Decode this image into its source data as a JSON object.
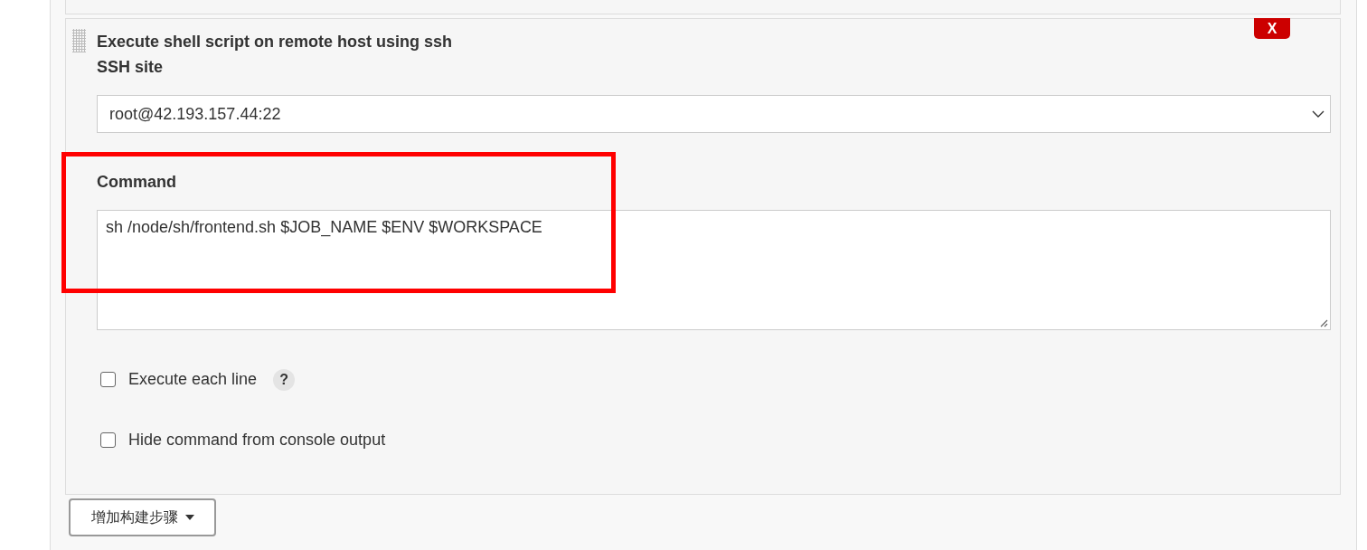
{
  "build_step": {
    "title": "Execute shell script on remote host using ssh",
    "delete_button": "X",
    "ssh_site": {
      "label": "SSH site",
      "value": "root@42.193.157.44:22"
    },
    "command": {
      "label": "Command",
      "value": "sh /node/sh/frontend.sh $JOB_NAME $ENV $WORKSPACE"
    },
    "options": [
      {
        "label": "Execute each line",
        "checked": false,
        "help": "?"
      },
      {
        "label": "Hide command from console output",
        "checked": false
      }
    ]
  },
  "add_step_button": "增加构建步骤"
}
